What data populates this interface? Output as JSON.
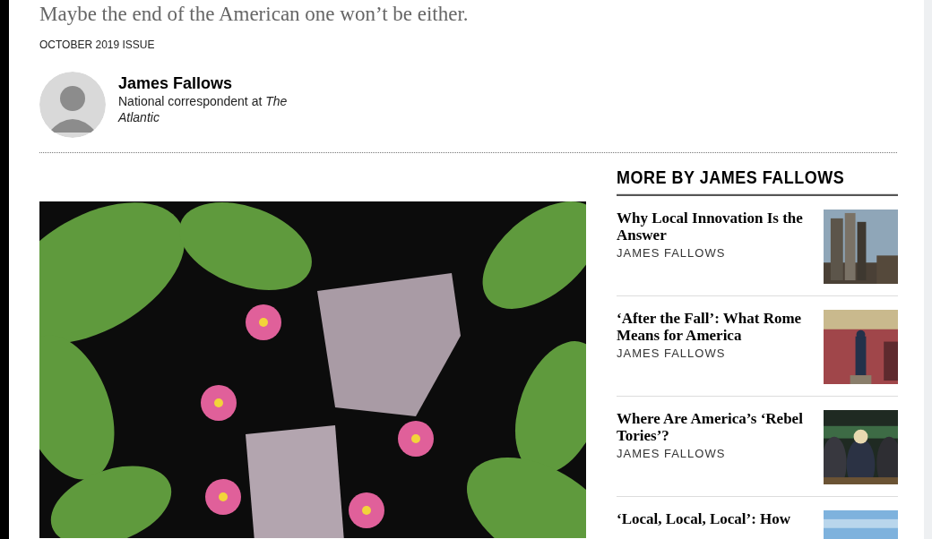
{
  "article": {
    "subtitle": "Maybe the end of the American one won’t be either.",
    "issue": "OCTOBER 2019 ISSUE"
  },
  "author": {
    "name": "James Fallows",
    "bio": "National correspondent at *The Atlantic*"
  },
  "sidebar": {
    "heading": "MORE BY JAMES FALLOWS",
    "items": [
      {
        "title": "Why Local Innovation Is the Answer",
        "author": "JAMES FALLOWS"
      },
      {
        "title": "‘After the Fall’: What Rome Means for America",
        "author": "JAMES FALLOWS"
      },
      {
        "title": "Where Are America’s ‘Rebel Tories’?",
        "author": "JAMES FALLOWS"
      },
      {
        "title": "‘Local, Local, Local’: How"
      }
    ]
  }
}
